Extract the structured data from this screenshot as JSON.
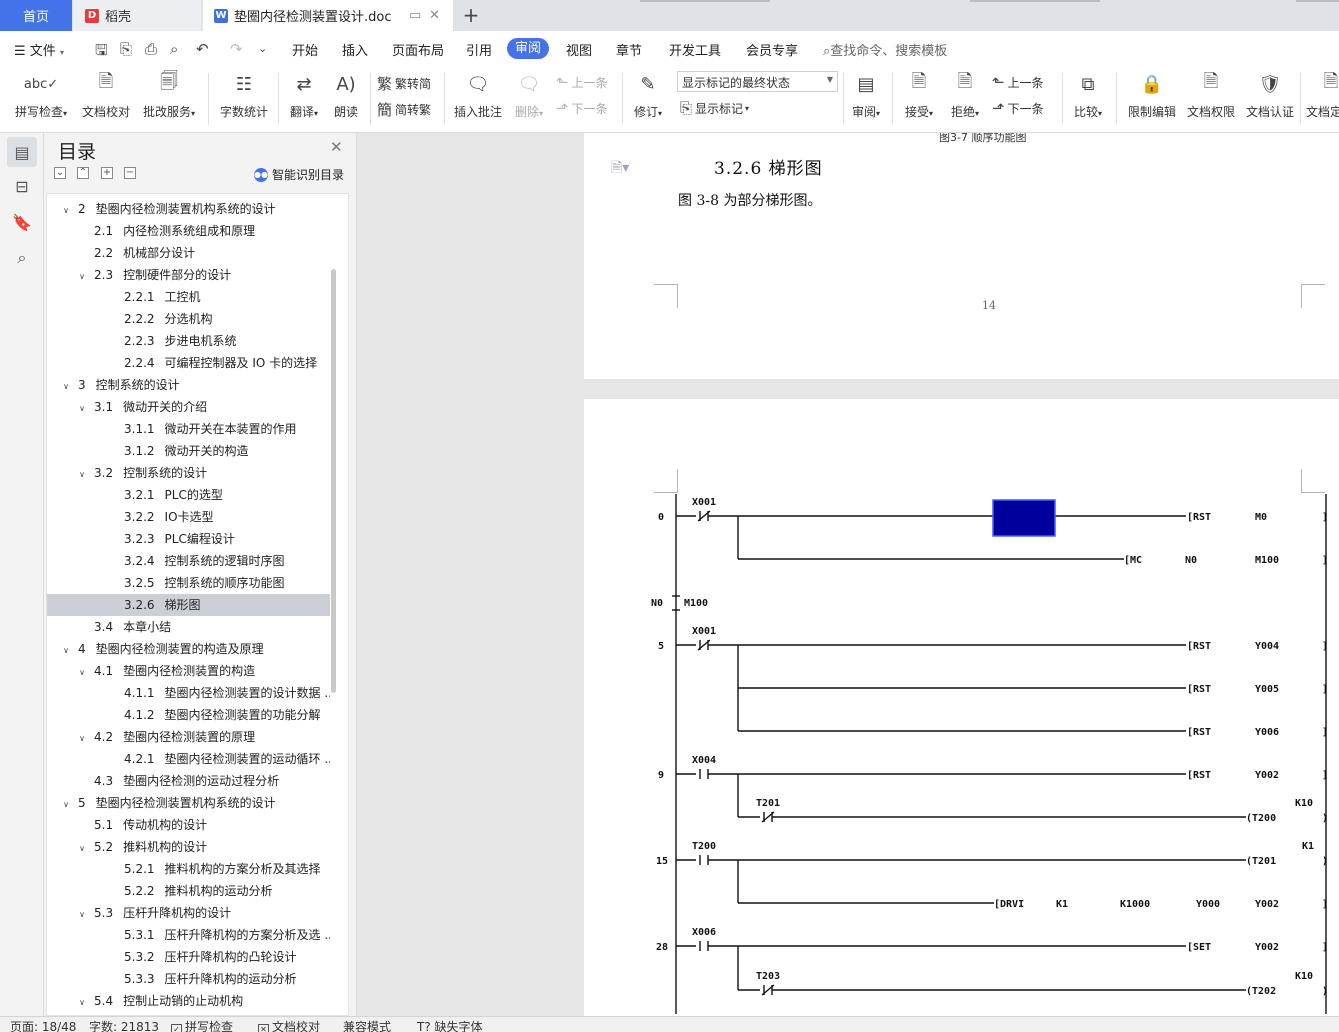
{
  "tabs": {
    "home": "首页",
    "daoke": "稻壳",
    "doc": "垫圈内径检测装置设计.doc"
  },
  "menu": {
    "file": "文件",
    "items": [
      "开始",
      "插入",
      "页面布局",
      "引用",
      "审阅",
      "视图",
      "章节",
      "开发工具",
      "会员专享"
    ],
    "search": "查找命令、搜索模板"
  },
  "ribbon": {
    "spellcheck": "拼写检查",
    "doccheck": "文档校对",
    "correct": "批改服务",
    "wordcount": "字数统计",
    "translate": "翻译",
    "read": "朗读",
    "trad": "繁转简",
    "simp": "简转繁",
    "insert_comment": "插入批注",
    "delete": "删除",
    "prev_comment": "上一条",
    "next_comment": "下一条",
    "revise": "修订",
    "track_state": "显示标记的最终状态",
    "show_marks": "显示标记",
    "review": "审阅",
    "accept": "接受",
    "reject": "拒绝",
    "prev_change": "上一条",
    "next_change": "下一条",
    "compare": "比较",
    "restrict": "限制编辑",
    "rights": "文档权限",
    "cert": "文档认证",
    "finalize": "文档定"
  },
  "toc": {
    "title": "目录",
    "smart": "智能识别目录",
    "items": [
      {
        "num": "2",
        "text": "垫圈内径检测装置机构系统的设计",
        "level": 1,
        "expand": true
      },
      {
        "num": "2.1",
        "text": "内径检测系统组成和原理",
        "level": 2,
        "expand": false
      },
      {
        "num": "2.2",
        "text": "机械部分设计",
        "level": 2,
        "expand": false
      },
      {
        "num": "2.3",
        "text": "控制硬件部分的设计",
        "level": 2,
        "expand": true
      },
      {
        "num": "2.2.1",
        "text": "工控机",
        "level": 3,
        "expand": false
      },
      {
        "num": "2.2.2",
        "text": "分选机构",
        "level": 3,
        "expand": false
      },
      {
        "num": "2.2.3",
        "text": "步进电机系统",
        "level": 3,
        "expand": false
      },
      {
        "num": "2.2.4",
        "text": "可编程控制器及 IO 卡的选择",
        "level": 3,
        "expand": false
      },
      {
        "num": "3",
        "text": "控制系统的设计",
        "level": 1,
        "expand": true
      },
      {
        "num": "3.1",
        "text": "微动开关的介绍",
        "level": 2,
        "expand": true
      },
      {
        "num": "3.1.1",
        "text": "微动开关在本装置的作用",
        "level": 3,
        "expand": false
      },
      {
        "num": "3.1.2",
        "text": "微动开关的构造",
        "level": 3,
        "expand": false
      },
      {
        "num": "3.2",
        "text": "控制系统的设计",
        "level": 2,
        "expand": true
      },
      {
        "num": "3.2.1",
        "text": "PLC的选型",
        "level": 3,
        "expand": false
      },
      {
        "num": "3.2.2",
        "text": "IO卡选型",
        "level": 3,
        "expand": false
      },
      {
        "num": "3.2.3",
        "text": "PLC编程设计",
        "level": 3,
        "expand": false
      },
      {
        "num": "3.2.4",
        "text": "控制系统的逻辑时序图",
        "level": 3,
        "expand": false
      },
      {
        "num": "3.2.5",
        "text": "控制系统的顺序功能图",
        "level": 3,
        "expand": false
      },
      {
        "num": "3.2.6",
        "text": "梯形图",
        "level": 3,
        "expand": false,
        "selected": true
      },
      {
        "num": "3.4",
        "text": "本章小结",
        "level": 2,
        "expand": false
      },
      {
        "num": "4",
        "text": "垫圈内径检测装置的构造及原理",
        "level": 1,
        "expand": true
      },
      {
        "num": "4.1",
        "text": "垫圈内径检测装置的构造",
        "level": 2,
        "expand": true
      },
      {
        "num": "4.1.1",
        "text": "垫圈内径检测装置的设计数据 ...",
        "level": 3,
        "expand": false
      },
      {
        "num": "4.1.2",
        "text": "垫圈内径检测装置的功能分解",
        "level": 3,
        "expand": false
      },
      {
        "num": "4.2",
        "text": "垫圈内径检测装置的原理",
        "level": 2,
        "expand": true
      },
      {
        "num": "4.2.1",
        "text": "垫圈内径检测装置的运动循环 ...",
        "level": 3,
        "expand": false
      },
      {
        "num": "4.3",
        "text": "垫圈内径检测的运动过程分析",
        "level": 2,
        "expand": false
      },
      {
        "num": "5",
        "text": "垫圈内径检测装置机构系统的设计",
        "level": 1,
        "expand": true
      },
      {
        "num": "5.1",
        "text": "传动机构的设计",
        "level": 2,
        "expand": false
      },
      {
        "num": "5.2",
        "text": "推料机构的设计",
        "level": 2,
        "expand": true
      },
      {
        "num": "5.2.1",
        "text": "推料机构的方案分析及其选择",
        "level": 3,
        "expand": false
      },
      {
        "num": "5.2.2",
        "text": "推料机构的运动分析",
        "level": 3,
        "expand": false
      },
      {
        "num": "5.3",
        "text": "压杆升降机构的设计",
        "level": 2,
        "expand": true
      },
      {
        "num": "5.3.1",
        "text": "压杆升降机构的方案分析及选 ...",
        "level": 3,
        "expand": false
      },
      {
        "num": "5.3.2",
        "text": "压杆升降机构的凸轮设计",
        "level": 3,
        "expand": false
      },
      {
        "num": "5.3.3",
        "text": "压杆升降机构的运动分析",
        "level": 3,
        "expand": false
      },
      {
        "num": "5.4",
        "text": "控制止动销的止动机构",
        "level": 2,
        "expand": true
      }
    ]
  },
  "document": {
    "caption_top": "图3-7 顺序功能图",
    "heading": "3.2.6   梯形图",
    "paragraph": "图 3-8 为部分梯形图。",
    "page_number": "14",
    "ladder": {
      "rungs": [
        {
          "step": "0",
          "contact": "X001",
          "nc": true,
          "outputs": [
            [
              "RST",
              "",
              "M0"
            ],
            [
              "MC",
              "N0",
              "M100"
            ]
          ]
        },
        {
          "step": "",
          "mcr": "N0",
          "mcr_label": "M100"
        },
        {
          "step": "5",
          "contact": "X001",
          "nc": true,
          "outputs": [
            [
              "RST",
              "",
              "Y004"
            ],
            [
              "RST",
              "",
              "Y005"
            ],
            [
              "RST",
              "",
              "Y006"
            ]
          ]
        },
        {
          "step": "9",
          "contact": "X004",
          "nc": false,
          "outputs": [
            [
              "RST",
              "",
              "Y002"
            ],
            [
              "T200",
              "K10",
              ""
            ]
          ],
          "branch": "T201"
        },
        {
          "step": "15",
          "contact": "T200",
          "nc": false,
          "outputs": [
            [
              "T201",
              "K1",
              ""
            ],
            [
              "DRVI",
              "K1 K1000 Y000",
              "Y002"
            ]
          ]
        },
        {
          "step": "28",
          "contact": "X006",
          "nc": false,
          "outputs": [
            [
              "SET",
              "",
              "Y002"
            ],
            [
              "T202",
              "K10",
              ""
            ]
          ],
          "branch": "T203"
        }
      ]
    }
  },
  "status": {
    "page": "页面: 18/48",
    "words": "字数: 21813",
    "spell": "拼写检查",
    "proof": "文档校对",
    "compat": "兼容模式",
    "font": "缺失字体"
  },
  "colors": {
    "accent": "#4472e8",
    "highlight": "#00009c",
    "toc_selected": "#ccd0d6"
  }
}
